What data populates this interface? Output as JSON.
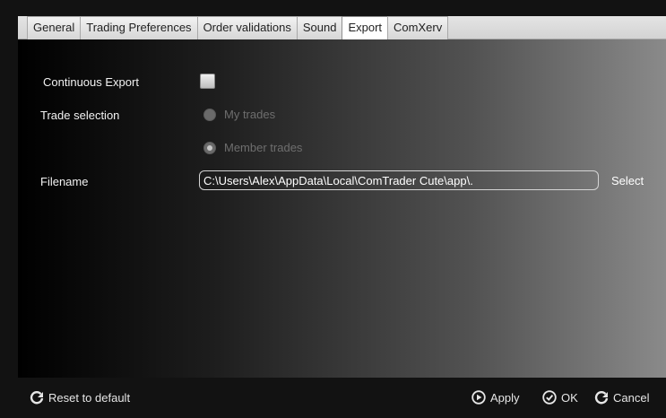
{
  "tabs": [
    {
      "label": "General",
      "active": false
    },
    {
      "label": "Trading Preferences",
      "active": false
    },
    {
      "label": "Order validations",
      "active": false
    },
    {
      "label": "Sound",
      "active": false
    },
    {
      "label": "Export",
      "active": true
    },
    {
      "label": "ComXerv",
      "active": false
    }
  ],
  "export": {
    "continuous_export_label": "Continuous Export",
    "continuous_export_checked": false,
    "trade_selection_label": "Trade selection",
    "options": [
      {
        "label": "My trades",
        "checked": false
      },
      {
        "label": "Member trades",
        "checked": true
      }
    ],
    "filename_label": "Filename",
    "filename_value": "C:\\Users\\Alex\\AppData\\Local\\ComTrader Cute\\app\\.",
    "select_label": "Select"
  },
  "footer": {
    "reset_label": "Reset to default",
    "apply_label": "Apply",
    "ok_label": "OK",
    "cancel_label": "Cancel"
  },
  "icons": {
    "reset": "refresh-icon",
    "apply": "play-circle-icon",
    "ok": "check-circle-icon",
    "cancel": "refresh-icon"
  },
  "colors": {
    "active_tab": "#ffffff",
    "disabled_text": "#6e6e6e"
  }
}
